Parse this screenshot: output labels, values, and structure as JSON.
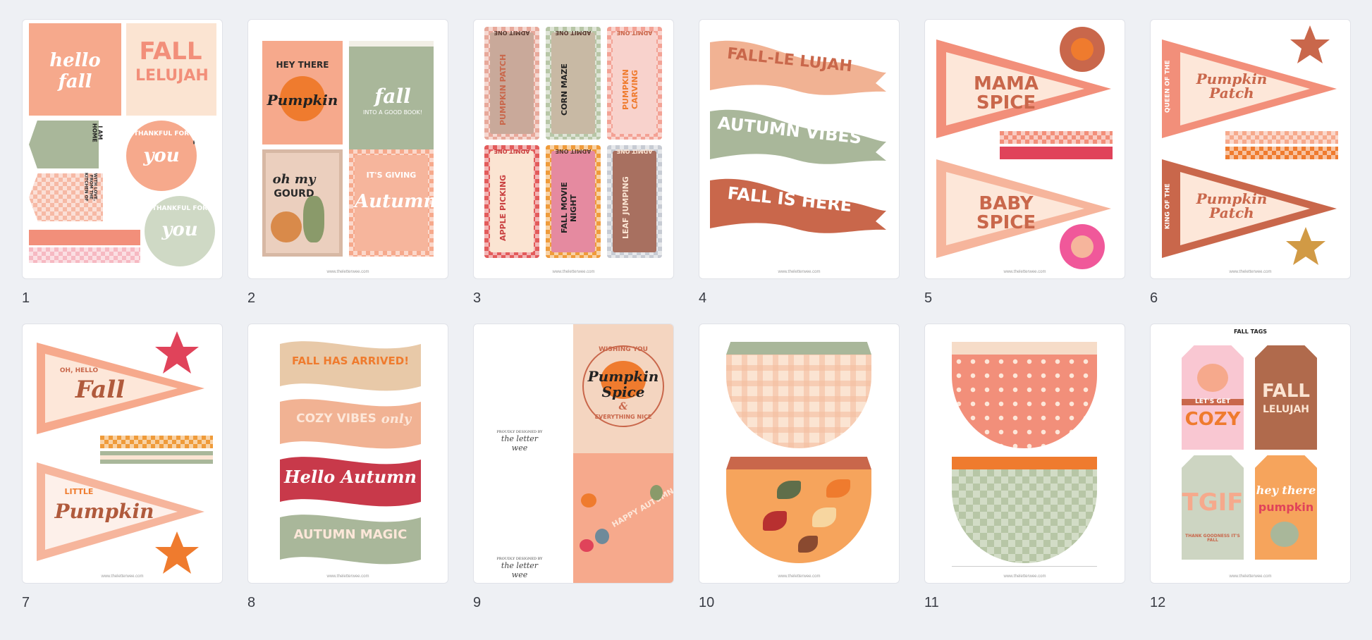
{
  "pages": [
    {
      "num": "1"
    },
    {
      "num": "2"
    },
    {
      "num": "3"
    },
    {
      "num": "4"
    },
    {
      "num": "5"
    },
    {
      "num": "6"
    },
    {
      "num": "7"
    },
    {
      "num": "8"
    },
    {
      "num": "9"
    },
    {
      "num": "10"
    },
    {
      "num": "11"
    },
    {
      "num": "12"
    }
  ],
  "footer_url": "www.theletterwee.com",
  "p1": {
    "hello": "hello",
    "fall": "fall",
    "lelujah1": "FALL",
    "lelujah2": "LELUJAH",
    "thankful": "THANKFUL FOR",
    "you": "you",
    "thankful2": "THANKFUL FOR",
    "you2": "you",
    "iamhome": "I AM HOME",
    "withlove": "WITH LOVE, FROM THE KITCHEN OF"
  },
  "p2": {
    "heythere": "HEY THERE",
    "pumpkin": "Pumpkin",
    "fall": "fall",
    "intobook": "INTO A GOOD BOOK!",
    "ohmy": "oh my",
    "gourd": "GOURD",
    "giving": "IT'S GIVING",
    "autumn": "Autumn"
  },
  "p3": {
    "admit": "ADMIT ONE",
    "tickets": [
      "PUMPKIN PATCH",
      "CORN MAZE",
      "PUMPKIN CARVING",
      "APPLE PICKING",
      "FALL MOVIE NIGHT",
      "LEAF JUMPING"
    ]
  },
  "p4": {
    "b1": "FALL-LE LUJAH",
    "b2": "AUTUMN VIBES",
    "b3": "FALL IS HERE"
  },
  "p5": {
    "b1": "MAMA SPICE",
    "b2": "BABY SPICE"
  },
  "p6": {
    "q": "QUEEN OF THE",
    "k": "KING OF THE",
    "pp": "Pumpkin Patch"
  },
  "p7": {
    "oh": "OH, HELLO",
    "fall": "Fall",
    "little": "LITTLE",
    "pumpkin": "Pumpkin"
  },
  "p8": {
    "b1": "FALL HAS ARRIVED!",
    "b2": "COZY VIBES",
    "b2b": "only",
    "b3": "Hello Autumn",
    "b4": "AUTUMN MAGIC"
  },
  "p9": {
    "sig": "the letter wee",
    "sigsub": "PROUDLY DESIGNED BY",
    "wishing": "WISHING YOU",
    "ps1": "Pumpkin",
    "ps2": "Spice",
    "amp": "&",
    "nice": "EVERYTHING NICE",
    "happy": "HAPPY AUTUMN"
  },
  "p12": {
    "title": "FALL TAGS",
    "cozy1": "LET'S GET",
    "cozy2": "COZY",
    "fl1": "FALL",
    "fl2": "LELUJAH",
    "tgif": "TGIF",
    "tgifsub": "THANK GOODNESS IT'S FALL",
    "hey": "hey there",
    "pumpkin": "pumpkin"
  },
  "colors": {
    "bg": "#eef0f4",
    "peach": "#f6a98c",
    "salmon": "#f28f7a",
    "sage": "#a9b79a",
    "rust": "#c9674b",
    "orange": "#ef7b2e",
    "cream": "#fbe4d2"
  }
}
